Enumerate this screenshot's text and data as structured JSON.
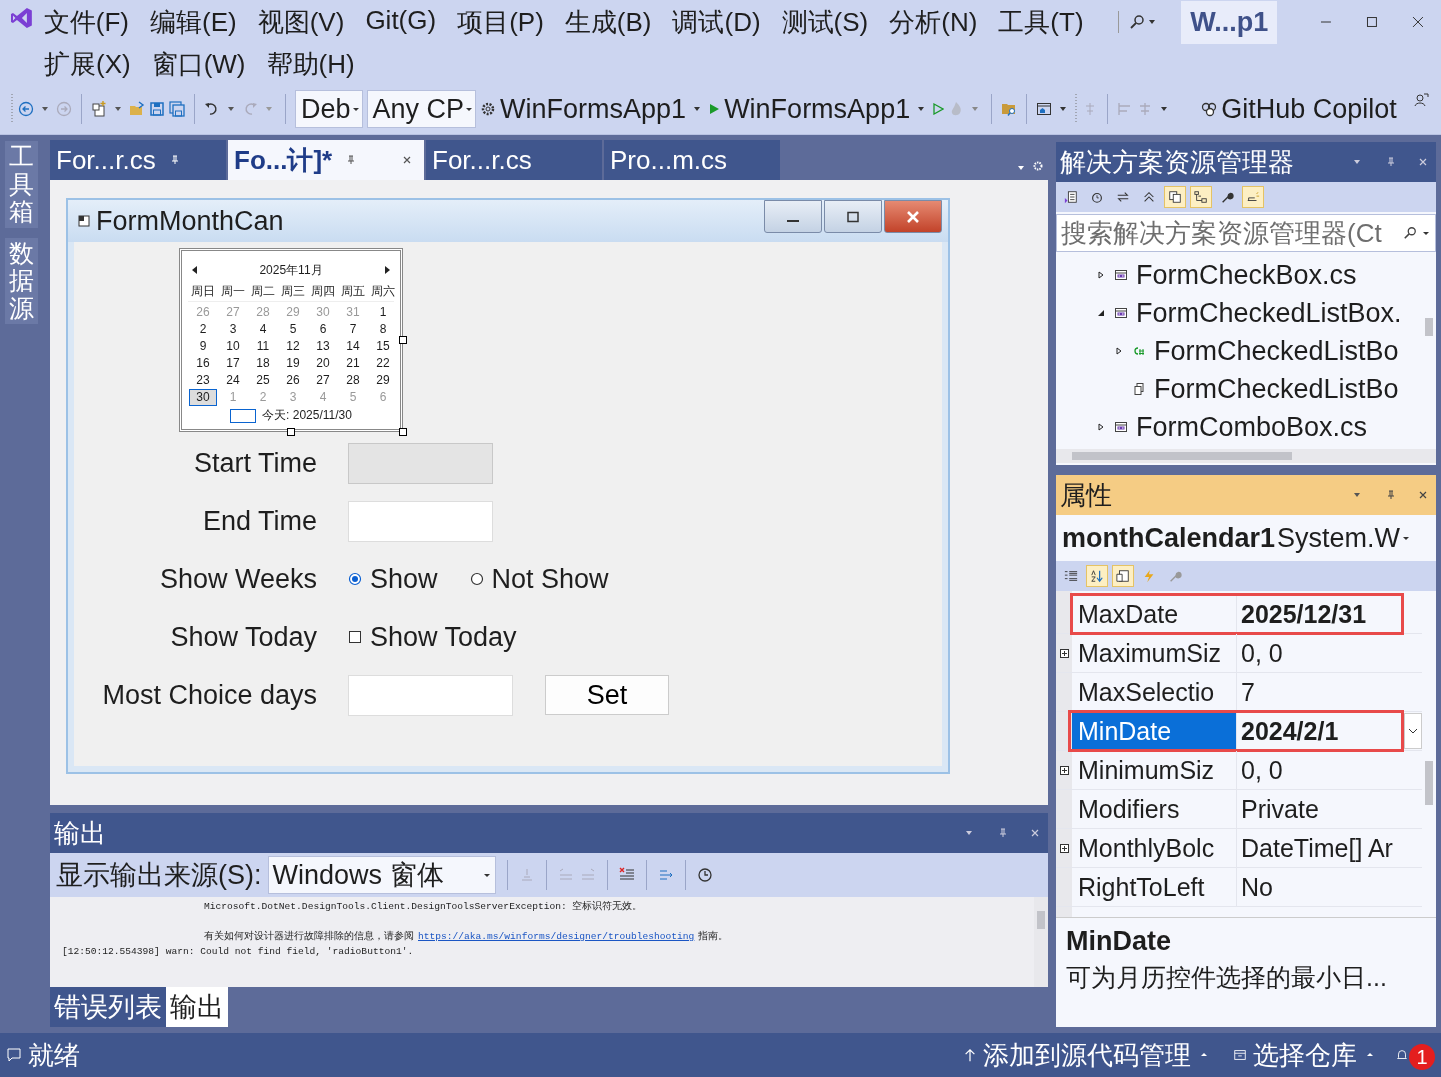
{
  "menu_bar": {
    "rows": [
      [
        "文件(F)",
        "编辑(E)",
        "视图(V)",
        "Git(G)",
        "项目(P)",
        "生成(B)",
        "调试(D)",
        "测试(S)",
        "分析(N)",
        "工具(T)"
      ],
      [
        "扩展(X)",
        "窗口(W)",
        "帮助(H)"
      ]
    ],
    "title": "W...p1"
  },
  "toolbar": {
    "configuration": "Deb",
    "platform": "Any CP",
    "startup_project": "WinFormsApp1",
    "run_target": "WinFormsApp1",
    "copilot": "GitHub Copilot"
  },
  "side_tabs": [
    "工具箱",
    "数据源"
  ],
  "document_tabs": [
    {
      "label": "For...r.cs",
      "selected": false,
      "pinned": true
    },
    {
      "label": "Fo...计]*",
      "selected": true,
      "pinned": true
    },
    {
      "label": "For...r.cs",
      "selected": false,
      "pinned": false
    },
    {
      "label": "Pro...m.cs",
      "selected": false,
      "pinned": false
    }
  ],
  "form": {
    "title": "FormMonthCan",
    "calendar": {
      "month": "2025年11月",
      "weekdays": [
        "周日",
        "周一",
        "周二",
        "周三",
        "周四",
        "周五",
        "周六"
      ],
      "weeks": [
        [
          {
            "day": "26",
            "other_month": true,
            "selected": false
          },
          {
            "day": "27",
            "other_month": true,
            "selected": false
          },
          {
            "day": "28",
            "other_month": true,
            "selected": false
          },
          {
            "day": "29",
            "other_month": true,
            "selected": false
          },
          {
            "day": "30",
            "other_month": true,
            "selected": false
          },
          {
            "day": "31",
            "other_month": true,
            "selected": false
          },
          {
            "day": "1",
            "other_month": false,
            "selected": false
          }
        ],
        [
          {
            "day": "2",
            "other_month": false,
            "selected": false
          },
          {
            "day": "3",
            "other_month": false,
            "selected": false
          },
          {
            "day": "4",
            "other_month": false,
            "selected": false
          },
          {
            "day": "5",
            "other_month": false,
            "selected": false
          },
          {
            "day": "6",
            "other_month": false,
            "selected": false
          },
          {
            "day": "7",
            "other_month": false,
            "selected": false
          },
          {
            "day": "8",
            "other_month": false,
            "selected": false
          }
        ],
        [
          {
            "day": "9",
            "other_month": false,
            "selected": false
          },
          {
            "day": "10",
            "other_month": false,
            "selected": false
          },
          {
            "day": "11",
            "other_month": false,
            "selected": false
          },
          {
            "day": "12",
            "other_month": false,
            "selected": false
          },
          {
            "day": "13",
            "other_month": false,
            "selected": false
          },
          {
            "day": "14",
            "other_month": false,
            "selected": false
          },
          {
            "day": "15",
            "other_month": false,
            "selected": false
          }
        ],
        [
          {
            "day": "16",
            "other_month": false,
            "selected": false
          },
          {
            "day": "17",
            "other_month": false,
            "selected": false
          },
          {
            "day": "18",
            "other_month": false,
            "selected": false
          },
          {
            "day": "19",
            "other_month": false,
            "selected": false
          },
          {
            "day": "20",
            "other_month": false,
            "selected": false
          },
          {
            "day": "21",
            "other_month": false,
            "selected": false
          },
          {
            "day": "22",
            "other_month": false,
            "selected": false
          }
        ],
        [
          {
            "day": "23",
            "other_month": false,
            "selected": false
          },
          {
            "day": "24",
            "other_month": false,
            "selected": false
          },
          {
            "day": "25",
            "other_month": false,
            "selected": false
          },
          {
            "day": "26",
            "other_month": false,
            "selected": false
          },
          {
            "day": "27",
            "other_month": false,
            "selected": false
          },
          {
            "day": "28",
            "other_month": false,
            "selected": false
          },
          {
            "day": "29",
            "other_month": false,
            "selected": false
          }
        ],
        [
          {
            "day": "30",
            "other_month": false,
            "selected": true
          },
          {
            "day": "1",
            "other_month": true,
            "selected": false
          },
          {
            "day": "2",
            "other_month": true,
            "selected": false
          },
          {
            "day": "3",
            "other_month": true,
            "selected": false
          },
          {
            "day": "4",
            "other_month": true,
            "selected": false
          },
          {
            "day": "5",
            "other_month": true,
            "selected": false
          },
          {
            "day": "6",
            "other_month": true,
            "selected": false
          }
        ]
      ],
      "today": "今天: 2025/11/30"
    },
    "rows": [
      {
        "kind": "input",
        "label": "Start Time",
        "disabled": true
      },
      {
        "kind": "input",
        "label": "End Time",
        "disabled": false
      },
      {
        "kind": "radio",
        "label": "Show Weeks",
        "options": [
          {
            "label": "Show",
            "selected": true
          },
          {
            "label": "Not Show",
            "selected": false
          }
        ]
      },
      {
        "kind": "checkbox",
        "label": "Show Today",
        "option": "Show Today",
        "checked": false
      },
      {
        "kind": "input_button",
        "label": "Most Choice days",
        "button": "Set"
      }
    ]
  },
  "output": {
    "title": "输出",
    "source_label": "显示输出来源(S):",
    "source": "Windows 窗体",
    "lines": [
      {
        "kind": "plain",
        "indented": true,
        "blank_line_before": false,
        "text": "Microsoft.DotNet.DesignTools.Client.DesignToolsServerException: 空标识符无效。"
      },
      {
        "kind": "link",
        "indented": true,
        "blank_line_before": true,
        "text": "有关如何对设计器进行故障排除的信息，请参阅",
        "link": "https://aka.ms/winforms/designer/troubleshooting",
        "after": "指南。"
      },
      {
        "kind": "plain",
        "indented": false,
        "blank_line_before": false,
        "text": "[12:50:12.554398] warn: Could not find field, 'radioButton1'."
      }
    ],
    "tabs": [
      {
        "label": "错误列表",
        "selected": false
      },
      {
        "label": "输出",
        "selected": true
      }
    ]
  },
  "solution_explorer": {
    "title": "解决方案资源管理器",
    "toolbar": [
      {
        "kind": "properties",
        "on": false
      },
      {
        "kind": "history",
        "on": false
      },
      {
        "kind": "sync",
        "on": false
      },
      {
        "kind": "collapse",
        "on": false
      },
      {
        "kind": "pages",
        "on": true
      },
      {
        "kind": "tree",
        "on": true
      },
      {
        "kind": "wrench",
        "on": false
      },
      {
        "kind": "preview",
        "on": true
      }
    ],
    "search": {
      "placeholder": "搜索解决方案资源管理器(Ct"
    },
    "items": [
      {
        "label": "FormCheckBox.cs",
        "kind": "form",
        "expanded": false
      },
      {
        "label": "FormCheckedListBox.",
        "kind": "form",
        "expanded": true,
        "children": [
          {
            "label": "FormCheckedListBo",
            "kind": "csharp",
            "expanded": false
          },
          {
            "label": "FormCheckedListBo",
            "kind": "resource"
          }
        ]
      },
      {
        "label": "FormComboBox.cs",
        "kind": "form",
        "expanded": false
      }
    ]
  },
  "properties": {
    "title": "属性",
    "object_name": "monthCalendar1",
    "object_type": "System.W",
    "toolbar": [
      {
        "kind": "categorized",
        "on": false
      },
      {
        "kind": "alphabetical",
        "on": true
      },
      {
        "kind": "pages",
        "on": true
      },
      {
        "kind": "events",
        "on": false
      },
      {
        "kind": "wrench",
        "on": false
      }
    ],
    "rows": [
      {
        "name": "MaxDate",
        "value": "2025/12/31",
        "expandable": false,
        "value_bold": true,
        "selected": false,
        "annotated": true
      },
      {
        "name": "MaximumSiz",
        "value": "0, 0",
        "expandable": true,
        "value_bold": false,
        "selected": false,
        "annotated": false
      },
      {
        "name": "MaxSelectio",
        "value": "7",
        "expandable": false,
        "value_bold": false,
        "selected": false,
        "annotated": false
      },
      {
        "name": "MinDate",
        "value": "2024/2/1",
        "expandable": false,
        "value_bold": true,
        "selected": true,
        "annotated": true
      },
      {
        "name": "MinimumSiz",
        "value": "0, 0",
        "expandable": true,
        "value_bold": false,
        "selected": false,
        "annotated": false
      },
      {
        "name": "Modifiers",
        "value": "Private",
        "expandable": false,
        "value_bold": false,
        "selected": false,
        "annotated": false
      },
      {
        "name": "MonthlyBolc",
        "value": "DateTime[] Ar",
        "expandable": true,
        "value_bold": false,
        "selected": false,
        "annotated": false
      },
      {
        "name": "RightToLeft",
        "value": "No",
        "expandable": false,
        "value_bold": false,
        "selected": false,
        "annotated": false
      }
    ],
    "description": {
      "name": "MinDate",
      "text": "可为月历控件选择的最小日..."
    }
  },
  "status_bar": {
    "state": "就绪",
    "source_control": "添加到源代码管理",
    "repository": "选择仓库",
    "notifications": "1"
  }
}
